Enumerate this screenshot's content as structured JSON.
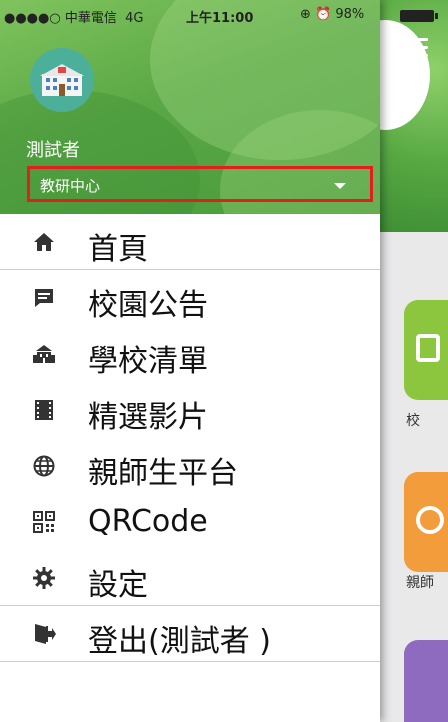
{
  "status_bar": {
    "signal": "●●●●○",
    "carrier": "中華電信",
    "network": "4G",
    "time": "上午11:00",
    "battery": "98%"
  },
  "profile": {
    "name": "測試者",
    "department": "教研中心"
  },
  "menu": {
    "items": [
      {
        "label": "首頁",
        "icon": "home-icon"
      },
      {
        "label": "校園公告",
        "icon": "message-icon"
      },
      {
        "label": "學校清單",
        "icon": "school-icon"
      },
      {
        "label": "精選影片",
        "icon": "film-icon"
      },
      {
        "label": "親師生平台",
        "icon": "globe-icon"
      },
      {
        "label": "QRCode",
        "icon": "qrcode-icon"
      },
      {
        "label": "設定",
        "icon": "gear-icon"
      },
      {
        "label": "登出(測試者 )",
        "icon": "logout-icon"
      }
    ]
  },
  "background_screen": {
    "labels": [
      "校",
      "親師"
    ]
  },
  "colors": {
    "header_green": "#5aa845",
    "highlight_red": "#e41e1e",
    "icon_gray": "#333333"
  }
}
